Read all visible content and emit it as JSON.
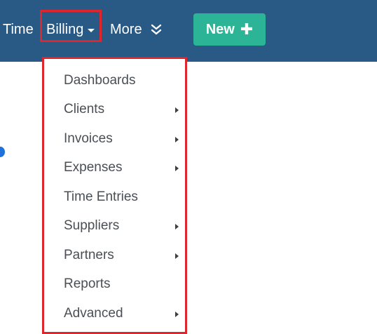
{
  "navbar": {
    "items": {
      "time": "Time",
      "billing": "Billing",
      "more": "More"
    },
    "new_button": {
      "label": "New",
      "icon": "plus-icon"
    },
    "colors": {
      "background": "#295a86",
      "new_button": "#2bb496",
      "highlight_border": "#e0262d"
    }
  },
  "billing_menu": {
    "items": [
      {
        "label": "Dashboards",
        "has_submenu": false
      },
      {
        "label": "Clients",
        "has_submenu": true
      },
      {
        "label": "Invoices",
        "has_submenu": true
      },
      {
        "label": "Expenses",
        "has_submenu": true
      },
      {
        "label": "Time Entries",
        "has_submenu": false
      },
      {
        "label": "Suppliers",
        "has_submenu": true
      },
      {
        "label": "Partners",
        "has_submenu": true
      },
      {
        "label": "Reports",
        "has_submenu": false
      },
      {
        "label": "Advanced",
        "has_submenu": true
      }
    ]
  }
}
